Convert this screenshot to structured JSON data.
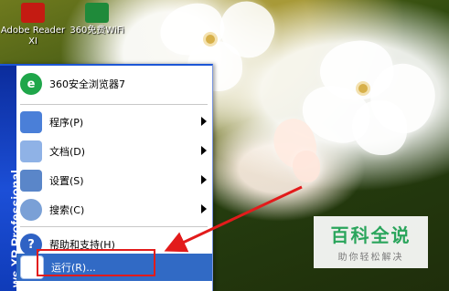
{
  "desktop_icons": [
    {
      "label": "Adobe Reader XI",
      "icon": "adobe-reader-icon"
    },
    {
      "label": "360免费WiFi",
      "icon": "wifi-icon"
    }
  ],
  "start_menu": {
    "top_item": {
      "label": "360安全浏览器7",
      "icon": "browser-360-icon"
    },
    "items": [
      {
        "label": "程序(P)",
        "icon": "programs-icon",
        "submenu": true
      },
      {
        "label": "文档(D)",
        "icon": "documents-icon",
        "submenu": true
      },
      {
        "label": "设置(S)",
        "icon": "settings-icon",
        "submenu": true
      },
      {
        "label": "搜索(C)",
        "icon": "search-icon",
        "submenu": true
      },
      {
        "label": "帮助和支持(H)",
        "icon": "help-icon",
        "submenu": false
      },
      {
        "label": "运行(R)...",
        "icon": "run-icon",
        "submenu": false,
        "selected": true
      }
    ],
    "side_banner": "ws XP Professional"
  },
  "watermark": {
    "title": "百科全说",
    "subtitle": "助你轻松解决"
  },
  "colors": {
    "menu_side": "#1c4fd7",
    "selection": "#316ac5",
    "highlight_box": "#e21b1b",
    "watermark_green": "#2aa55c"
  }
}
